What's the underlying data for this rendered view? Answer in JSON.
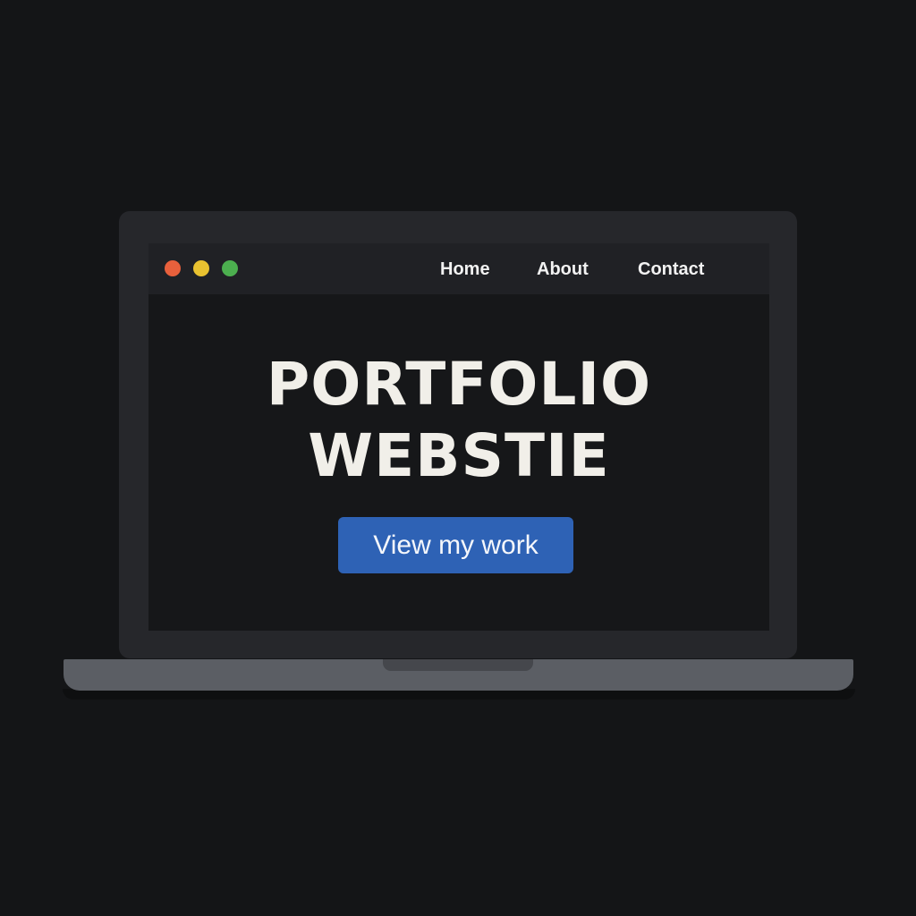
{
  "browser": {
    "window_controls": {
      "close_color": "#e8603c",
      "minimize_color": "#e9c230",
      "maximize_color": "#4caf4f"
    },
    "nav": {
      "items": [
        {
          "label": "Home"
        },
        {
          "label": "About"
        },
        {
          "label": "Contact"
        }
      ]
    }
  },
  "hero": {
    "title_line1": "PORTFOLIO",
    "title_line2": "WEBSTIE",
    "cta_label": "View my work",
    "cta_color": "#2e62b5"
  },
  "colors": {
    "page_background": "#141517",
    "bezel": "#26272b",
    "screen": "#161719",
    "title_text": "#f1efe9",
    "laptop_base": "#5b5e64"
  }
}
